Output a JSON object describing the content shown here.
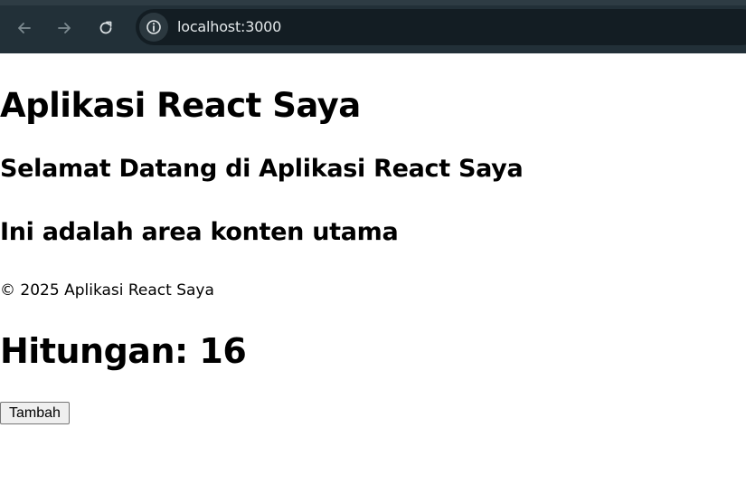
{
  "browser": {
    "url": "localhost:3000",
    "icons": {
      "back": "arrow-left-icon",
      "forward": "arrow-right-icon",
      "reload": "reload-icon",
      "site_info": "info-icon"
    }
  },
  "page": {
    "title": "Aplikasi React Saya",
    "welcome": "Selamat Datang di Aplikasi React Saya",
    "main_content": "Ini adalah area konten utama",
    "footer": "© 2025 Aplikasi React Saya",
    "counter_label": "Hitungan: 16",
    "add_button_label": "Tambah"
  }
}
